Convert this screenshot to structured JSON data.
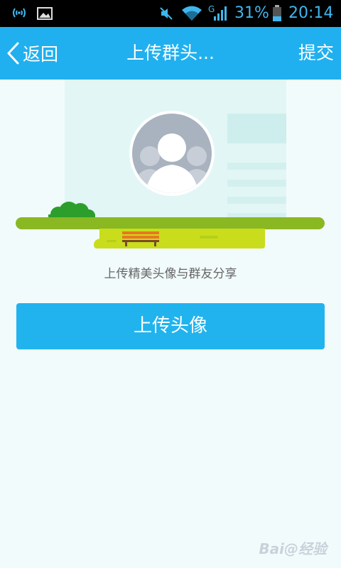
{
  "status_bar": {
    "battery_percent": "31%",
    "time": "20:14",
    "icons": [
      "wireless-signal-icon",
      "image-icon",
      "mute-icon",
      "wifi-icon",
      "cell-signal-icon",
      "battery-icon"
    ],
    "network_label": "G"
  },
  "title_bar": {
    "back_label": "返回",
    "title": "上传群头...",
    "submit_label": "提交",
    "background": "#20b0ef"
  },
  "content": {
    "tagline": "上传精美头像与群友分享",
    "upload_button_label": "上传头像",
    "button_color": "#21b3ee"
  },
  "watermark": {
    "text": "Bai@经验"
  }
}
